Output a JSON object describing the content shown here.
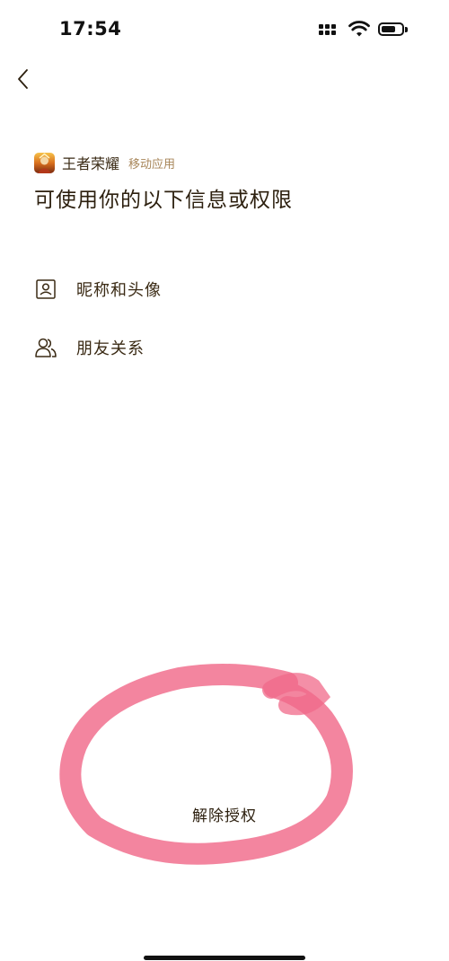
{
  "status_bar": {
    "time": "17:54",
    "icons": [
      "cellular-signal-icon",
      "wifi-icon",
      "battery-icon"
    ]
  },
  "nav": {
    "back_icon": "chevron-left-icon"
  },
  "app": {
    "name": "王者荣耀",
    "type": "移动应用",
    "icon": "app-game-icon"
  },
  "title": "可使用你的以下信息或权限",
  "permissions": [
    {
      "icon": "profile-card-icon",
      "label": "昵称和头像"
    },
    {
      "icon": "friends-icon",
      "label": "朋友关系"
    }
  ],
  "revoke_label": "解除授权",
  "colors": {
    "text": "#3a2a14",
    "secondary": "#a8865a",
    "annotation": "#f06a8a"
  }
}
